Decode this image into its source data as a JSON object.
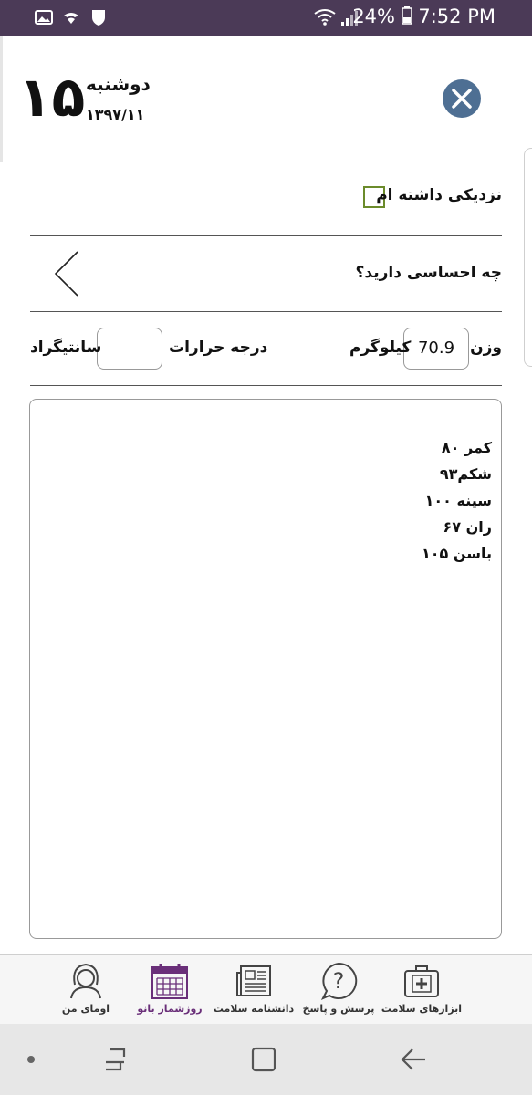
{
  "status_bar": {
    "battery": "24%",
    "time": "7:52 PM",
    "left_icons": [
      "image-icon",
      "cast-icon",
      "shield-icon"
    ],
    "right_icons": [
      "wifi-icon",
      "signal-icon",
      "battery-icon"
    ]
  },
  "header": {
    "day_number": "۱۵",
    "weekday": "دوشنبه",
    "date": "۱۳۹۷/۱۱"
  },
  "form": {
    "intimacy_label": "نزدیکی داشته ام",
    "intimacy_checked": false,
    "feeling_label": "چه احساسی دارید؟",
    "weight_label": "وزن",
    "weight_value": "70.9",
    "weight_unit": "کیلوگرم",
    "temperature_label": "درجه حرارات",
    "temperature_value": "",
    "temperature_unit": "سانتیگراد",
    "notes": [
      "کمر ۸۰",
      "شکم۹۳",
      "سینه ۱۰۰",
      "ران ۶۷",
      "باسن ۱۰۵"
    ]
  },
  "bottom_nav": {
    "items": [
      {
        "label": "ابزارهای سلامت",
        "icon": "medical-kit-icon",
        "active": false
      },
      {
        "label": "پرسش و پاسخ",
        "icon": "question-bubble-icon",
        "active": false
      },
      {
        "label": "دانشنامه سلامت",
        "icon": "newspaper-icon",
        "active": false
      },
      {
        "label": "روزشمار بانو",
        "icon": "calendar-icon",
        "active": true
      },
      {
        "label": "اومای من",
        "icon": "profile-icon",
        "active": false
      }
    ]
  },
  "android_nav": [
    "dot-icon",
    "recents-icon",
    "home-icon",
    "back-icon"
  ],
  "colors": {
    "status_bar": "#4b3a57",
    "close_button": "#4e6f93",
    "checkbox_border": "#6b8b2b",
    "active_nav": "#6a2f79"
  }
}
